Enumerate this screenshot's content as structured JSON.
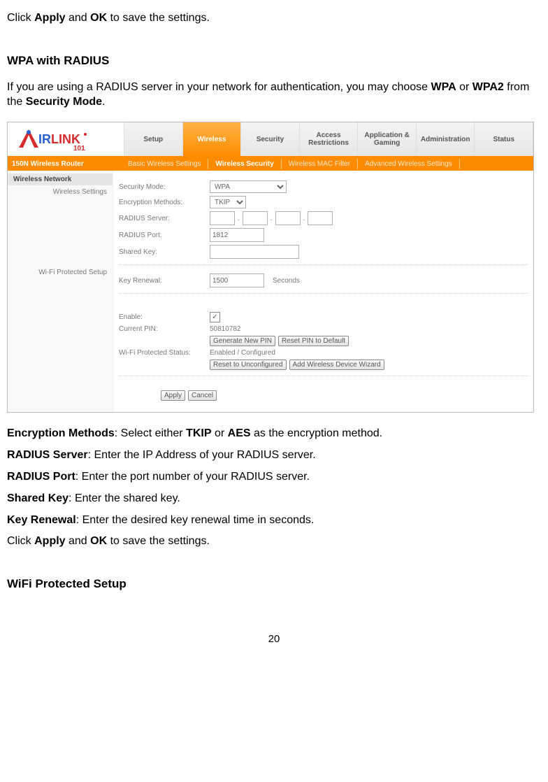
{
  "intro_line": {
    "pre": "Click ",
    "apply": "Apply",
    "and": " and ",
    "ok": "OK",
    "post": " to save the settings."
  },
  "section1_title": "WPA with RADIUS",
  "section1_para": {
    "pre": "If you are using a RADIUS server in your network for authentication, you may choose ",
    "wpa": "WPA",
    "or": " or ",
    "wpa2": "WPA2",
    "from": " from the ",
    "secmode": "Security Mode",
    "end": "."
  },
  "router": {
    "logo_text_1": "AIR",
    "logo_text_2": "LINK",
    "logo_sub": "101",
    "tabs": [
      "Setup",
      "Wireless",
      "Security",
      "Access Restrictions",
      "Application & Gaming",
      "Administration",
      "Status"
    ],
    "active_tab_index": 1,
    "subnav_title": "150N Wireless Router",
    "subnav": [
      "Basic Wireless Settings",
      "Wireless Security",
      "Wireless MAC Filter",
      "Advanced Wireless Settings"
    ],
    "subnav_active": 1,
    "side_header": "Wireless Network",
    "side_item1": "Wireless Settings",
    "side_item2": "Wi-Fi Protected Setup",
    "fields": {
      "security_mode_label": "Security Mode:",
      "security_mode_value": "WPA",
      "encryption_label": "Encryption Methods:",
      "encryption_value": "TKIP",
      "radius_server_label": "RADIUS Server:",
      "radius_port_label": "RADIUS Port:",
      "radius_port_value": "1812",
      "shared_key_label": "Shared Key:",
      "key_renewal_label": "Key Renewal:",
      "key_renewal_value": "1500",
      "seconds": "Seconds",
      "enable_label": "Enable:",
      "current_pin_label": "Current PIN:",
      "current_pin_value": "50810782",
      "gen_pin_btn": "Generate New PIN",
      "reset_pin_btn": "Reset PIN to Default",
      "wps_status_label": "Wi-Fi Protected Status:",
      "wps_status_value": "Enabled / Configured",
      "reset_unconf_btn": "Reset to Unconfigured",
      "add_device_btn": "Add Wireless Device Wizard",
      "apply_btn": "Apply",
      "cancel_btn": "Cancel"
    }
  },
  "defs": {
    "enc_label": "Encryption Methods",
    "enc_text": ": Select either ",
    "tkip": "TKIP",
    "or": " or ",
    "aes": "AES",
    "enc_end": " as the encryption method.",
    "rserver_label": "RADIUS Server",
    "rserver_text": ": Enter the IP Address of your RADIUS server.",
    "rport_label": "RADIUS Port",
    "rport_text": ": Enter the port number of your RADIUS server.",
    "skey_label": "Shared Key",
    "skey_text": ": Enter the shared key.",
    "krenew_label": "Key Renewal",
    "krenew_text": ": Enter the desired key renewal time in seconds."
  },
  "closing": {
    "pre": "Click ",
    "apply": "Apply",
    "and": " and ",
    "ok": "OK",
    "post": " to save the settings."
  },
  "section2_title": "WiFi Protected Setup",
  "page_number": "20"
}
